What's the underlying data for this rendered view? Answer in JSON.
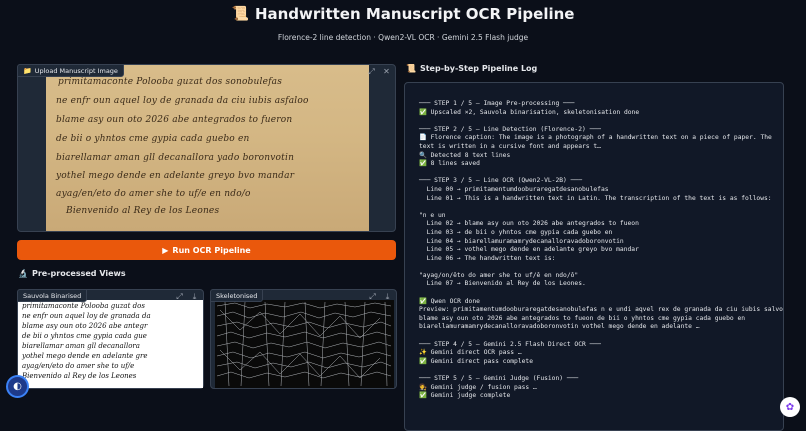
{
  "header": {
    "title": "Handwritten Manuscript OCR Pipeline",
    "subtitle": "Florence-2 line detection · Qwen2-VL OCR · Gemini 2.5 Flash judge"
  },
  "upload": {
    "label": "Upload Manuscript Image",
    "manuscript_lines": [
      "primitamaconte Polooba guzat dos sonobulefas",
      "ne enfr oun aquel loy de granada da ciu iubis asfaloo",
      "blame asy oun oto 2026 abe antegrados to fueron",
      "de bii o yhntos cme gypia cada guebo en",
      "biarellamar aman gll decanallora yado boronvotin",
      "yothel mego dende en adelante greyo bvo mandar",
      "ayag/en/eto do amer she to uf/e en ndo/o",
      "Bienvenido al Rey de los Leones"
    ]
  },
  "run_button": {
    "label": "Run OCR Pipeline"
  },
  "preprocessed": {
    "heading": "Pre-processed Views",
    "binarised_label": "Sauvola Binarised",
    "skeleton_label": "Skeletonised"
  },
  "log": {
    "heading": "Step-by-Step Pipeline Log",
    "lines": [
      "─── STEP 1 / 5 — Image Pre-processing ───",
      "✅ Upscaled ×2, Sauvola binarisation, skeletonisation done",
      "",
      "─── STEP 2 / 5 — Line Detection (Florence-2) ───",
      "📄 Florence caption: The image is a photograph of a handwritten text on a piece of paper. The",
      "text is written in a cursive font and appears t…",
      "🔍 Detected 8 text lines",
      "✅ 8 lines saved",
      "",
      "─── STEP 3 / 5 — Line OCR (Qwen2-VL-2B) ───",
      "  Line 00 → primitamentumdooburaregatdesanobulefas",
      "  Line 01 → This is a handwritten text in Latin. The transcription of the text is as follows:",
      "",
      "\"n e un",
      "  Line 02 → blame asy oun oto 2026 abe antegrados to fueon",
      "  Line 03 → de bii o yhntos cme gypia cada guebo en",
      "  Line 04 → biarellamuramamrydecanalloravadoboronvotin",
      "  Line 05 → vothel mego dende en adelante greyo bvo mandar",
      "  Line 06 → The handwritten text is:",
      "",
      "\"ayag/on/êto do amer she to uf/ê en ndo/ô\"",
      "  Line 07 → Bienvenido al Rey de los Leones.",
      "",
      "✅ Qwen OCR done",
      "Preview: primitamentumdooburaregatdesanobulefas n e undi aqvel rex de granada da ciu iubis salvo p",
      "blame asy oun oto 2026 abe antegrados to fueon de bii o yhntos cme gypia cada guebo en",
      "biarellamuramamrydecanalloravadoboronvotin vothel mego dende en adelante …",
      "",
      "─── STEP 4 / 5 — Gemini 2.5 Flash Direct OCR ───",
      "✨ Gemini direct OCR pass …",
      "✅ Gemini direct pass complete",
      "",
      "─── STEP 5 / 5 — Gemini Judge (Fusion) ───",
      "🧑‍⚖️ Gemini judge / fusion pass …",
      "✅ Gemini judge complete"
    ]
  },
  "colors": {
    "accent": "#ea580c",
    "background": "#0b0f19",
    "panel": "#1f2937"
  },
  "icons": {
    "title": "scroll-icon",
    "upload": "folder-icon",
    "views": "microscope-icon",
    "log": "scroll-icon"
  }
}
